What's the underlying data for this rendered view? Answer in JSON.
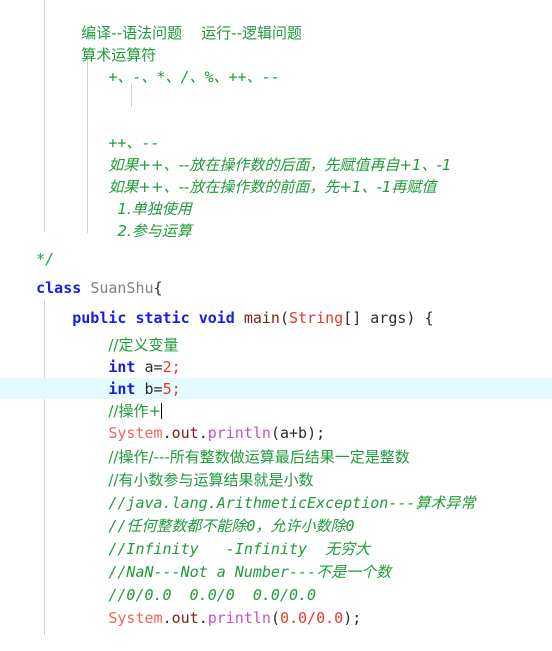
{
  "editor": {
    "language": "java",
    "file_class_name": "SuanShu",
    "colors": {
      "background": "#ffffff",
      "comment_green": "#1f9c3a",
      "keyword_blue": "#1a1ae6",
      "number_red": "#e8382b",
      "type_red": "#e8382b",
      "method_maroon": "#7a2020",
      "call_purple": "#c452c4",
      "system_salmon": "#f4655b",
      "class_grey": "#808080",
      "plain_text": "#2b2b2b",
      "indent_guide": "#d4d4d4",
      "caret_line_highlight": "#e3fbfc"
    },
    "caret": {
      "line_index": 14,
      "after_text": "//操作+",
      "line_highlight_visible": true
    },
    "lines": [
      {
        "index": 0,
        "indent": 5,
        "kind": "block-comment-cjk",
        "text": "编译--语法问题    运行--逻辑问题"
      },
      {
        "index": 1,
        "indent": 5,
        "kind": "block-comment-cjk",
        "text": "算术运算符"
      },
      {
        "index": 2,
        "indent": 8,
        "kind": "block-comment-mono",
        "text": "+、-、*、/、%、++、--"
      },
      {
        "index": 3,
        "indent": 8,
        "kind": "blank",
        "text": ""
      },
      {
        "index": 4,
        "indent": 8,
        "kind": "blank",
        "text": ""
      },
      {
        "index": 5,
        "indent": 8,
        "kind": "block-comment-mono",
        "text": "++、--"
      },
      {
        "index": 6,
        "indent": 8,
        "kind": "block-comment-cjk",
        "text": "如果++、--放在操作数的后面，先赋值再自+1、-1"
      },
      {
        "index": 7,
        "indent": 8,
        "kind": "block-comment-cjk",
        "text": "如果++、--放在操作数的前面，先+1、-1再赋值"
      },
      {
        "index": 8,
        "indent": 9,
        "kind": "block-comment-cjk",
        "text": "1.单独使用"
      },
      {
        "index": 9,
        "indent": 9,
        "kind": "block-comment-cjk",
        "text": "2.参与运算"
      },
      {
        "index": 10,
        "indent": 0,
        "kind": "block-comment-end",
        "text": "*/"
      },
      {
        "index": 11,
        "indent": 0,
        "kind": "code-class-decl",
        "text": "class SuanShu{"
      },
      {
        "index": 12,
        "indent": 4,
        "kind": "code-method-decl",
        "text": "public static void main(String[] args) {"
      },
      {
        "index": 13,
        "indent": 8,
        "kind": "line-comment-cjk",
        "text": "//定义变量"
      },
      {
        "index": 14,
        "indent": 8,
        "kind": "code-decl-int-a",
        "text": "int a=2;"
      },
      {
        "index": 15,
        "indent": 8,
        "kind": "code-decl-int-b",
        "text": "int b=5;"
      },
      {
        "index": 16,
        "indent": 8,
        "kind": "line-comment-caret",
        "text": "//操作+"
      },
      {
        "index": 17,
        "indent": 8,
        "kind": "code-println-ab",
        "text": "System.out.println(a+b);"
      },
      {
        "index": 18,
        "indent": 8,
        "kind": "line-comment-cjk",
        "text": "//操作/---所有整数做运算最后结果一定是整数"
      },
      {
        "index": 19,
        "indent": 8,
        "kind": "line-comment-cjk",
        "text": "//有小数参与运算结果就是小数"
      },
      {
        "index": 20,
        "indent": 8,
        "kind": "line-comment-mixed",
        "text": "//java.lang.ArithmeticException---算术异常"
      },
      {
        "index": 21,
        "indent": 8,
        "kind": "line-comment-mixed",
        "text": "//任何整数都不能除0，允许小数除0"
      },
      {
        "index": 22,
        "indent": 8,
        "kind": "line-comment-mixed",
        "text": "//Infinity   -Infinity  无穷大"
      },
      {
        "index": 23,
        "indent": 8,
        "kind": "line-comment-mixed",
        "text": "//NaN---Not a Number---不是一个数"
      },
      {
        "index": 24,
        "indent": 8,
        "kind": "line-comment-mono",
        "text": "//0/0.0  0.0/0  0.0/0.0"
      },
      {
        "index": 25,
        "indent": 8,
        "kind": "code-println-div",
        "text": "System.out.println(0.0/0.0);"
      }
    ],
    "tokens": {
      "block_comment_end": "*/",
      "kw_class": "class",
      "class_name": "SuanShu",
      "brace_open": "{",
      "kw_public": "public",
      "kw_static": "static",
      "kw_void": "void",
      "method_main": "main",
      "type_string": "String",
      "brackets": "[]",
      "param_args": "args",
      "paren_open": "(",
      "paren_close": ")",
      "kw_int": "int",
      "var_a": "a",
      "var_b": "b",
      "assign": "=",
      "num_2": "2",
      "num_5": "5",
      "semicolon": ";",
      "id_system": "System",
      "id_out": "out",
      "id_println": "println",
      "dot": ".",
      "expr_a_plus_b": "a+b",
      "expr_zero_div": "0.0/0.0",
      "comment_define_var": "//定义变量",
      "comment_caret_text": "//操作+"
    }
  }
}
